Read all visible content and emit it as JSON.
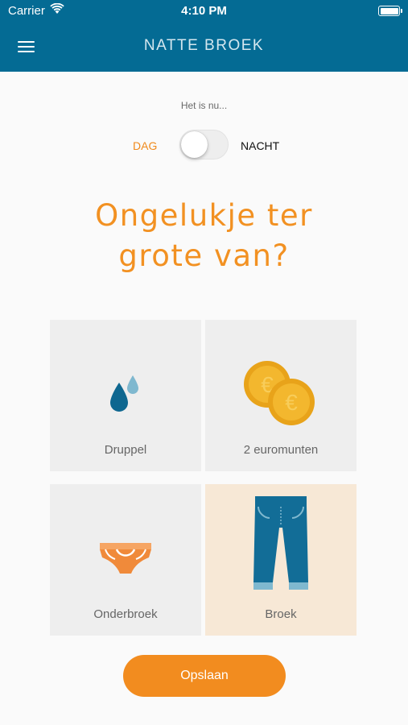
{
  "status_bar": {
    "carrier": "Carrier",
    "time": "4:10 PM"
  },
  "nav": {
    "title": "NATTE BROEK",
    "menu_icon": "hamburger-menu-icon"
  },
  "time_of_day": {
    "prompt": "Het is nu...",
    "day_label": "DAG",
    "night_label": "NACHT",
    "toggle_on_night": false
  },
  "question": "Ongelukje ter grote van?",
  "options": [
    {
      "label": "Druppel",
      "icon": "droplets-icon",
      "selected": false
    },
    {
      "label": "2 euromunten",
      "icon": "euro-coins-icon",
      "selected": false
    },
    {
      "label": "Onderbroek",
      "icon": "underpants-icon",
      "selected": false
    },
    {
      "label": "Broek",
      "icon": "jeans-icon",
      "selected": true
    }
  ],
  "save_label": "Opslaan",
  "colors": {
    "primary": "#046b94",
    "accent": "#f28c1f",
    "tile": "#eeeeee",
    "tile_selected": "#f7e8d6"
  }
}
